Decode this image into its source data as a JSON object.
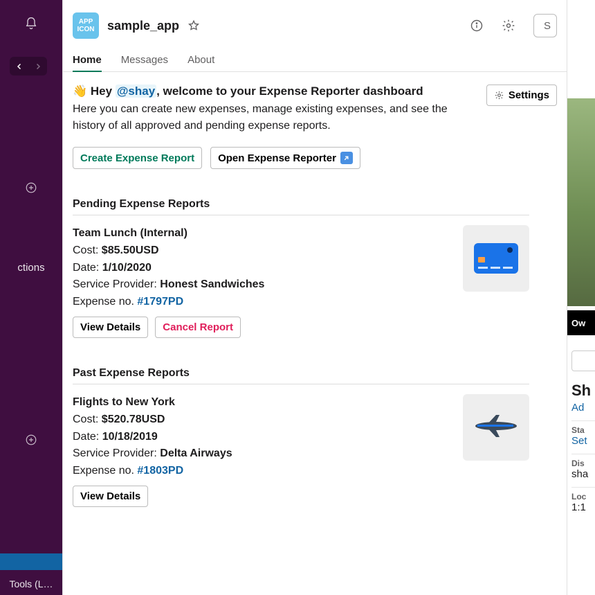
{
  "rail": {
    "connections_label": "ctions",
    "tools_label": "Tools (L…"
  },
  "header": {
    "app_icon_text": "APP ICON",
    "app_name": "sample_app",
    "search_placeholder": "S"
  },
  "tabs": [
    {
      "label": "Home",
      "active": true
    },
    {
      "label": "Messages",
      "active": false
    },
    {
      "label": "About",
      "active": false
    }
  ],
  "welcome": {
    "wave": "👋",
    "pre": "Hey ",
    "mention": "@shay",
    "post": ", welcome to your Expense Reporter dashboard",
    "body": "Here you can create new expenses, manage existing expenses, and see the history of all approved and pending expense reports.",
    "settings_label": "Settings",
    "create_label": "Create Expense Report",
    "open_label": "Open Expense Reporter"
  },
  "pending": {
    "title": "Pending Expense Reports",
    "report": {
      "title": "Team Lunch (Internal)",
      "cost_label": "Cost: ",
      "cost_value": "$85.50USD",
      "date_label": "Date: ",
      "date_value": "1/10/2020",
      "provider_label": "Service Provider: ",
      "provider_value": "Honest Sandwiches",
      "expense_label": "Expense no. ",
      "expense_value": "#1797PD",
      "view_label": "View Details",
      "cancel_label": "Cancel Report"
    }
  },
  "past": {
    "title": "Past Expense Reports",
    "report": {
      "title": "Flights to New York",
      "cost_label": "Cost: ",
      "cost_value": "$520.78USD",
      "date_label": "Date: ",
      "date_value": "10/18/2019",
      "provider_label": "Service Provider: ",
      "provider_value": "Delta Airways",
      "expense_label": "Expense no. ",
      "expense_value": "#1803PD",
      "view_label": "View Details"
    }
  },
  "profile": {
    "ow_label": "Ow",
    "name_initial": "Sh",
    "add_label": "Ad",
    "status_k": "Sta",
    "status_v": "Set",
    "display_k": "Dis",
    "display_v": "sha",
    "local_k": "Loc",
    "local_v": "1:1"
  }
}
